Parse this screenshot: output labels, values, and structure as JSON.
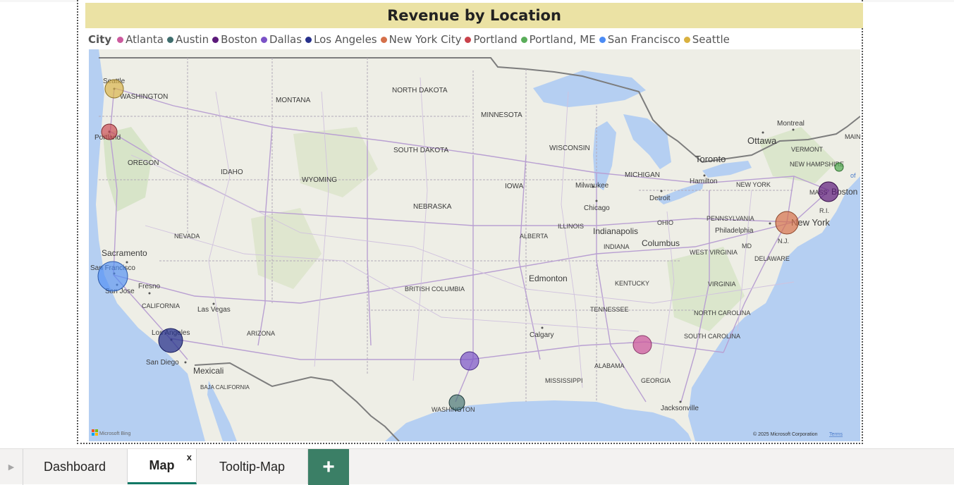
{
  "visual": {
    "title": "Revenue by Location"
  },
  "legend": {
    "title": "City",
    "items": [
      {
        "label": "Atlanta",
        "color": "#cc5a9e"
      },
      {
        "label": "Austin",
        "color": "#3f6e6e"
      },
      {
        "label": "Boston",
        "color": "#5c1a7a"
      },
      {
        "label": "Dallas",
        "color": "#7b52c7"
      },
      {
        "label": "Los Angeles",
        "color": "#27318c"
      },
      {
        "label": "New York City",
        "color": "#d5704a"
      },
      {
        "label": "Portland",
        "color": "#c9424b"
      },
      {
        "label": "Portland, ME",
        "color": "#5aad5a"
      },
      {
        "label": "San Francisco",
        "color": "#4c8cf5"
      },
      {
        "label": "Seattle",
        "color": "#d9b140"
      }
    ]
  },
  "map": {
    "bubbles": [
      {
        "city": "Seattle",
        "color": "#d9b140",
        "size": "medium"
      },
      {
        "city": "Portland",
        "color": "#c9424b",
        "size": "small"
      },
      {
        "city": "San Francisco",
        "color": "#4c8cf5",
        "size": "large"
      },
      {
        "city": "Los Angeles",
        "color": "#27318c",
        "size": "large"
      },
      {
        "city": "Dallas",
        "color": "#7b52c7",
        "size": "medium"
      },
      {
        "city": "Austin",
        "color": "#3f6e6e",
        "size": "small"
      },
      {
        "city": "Atlanta",
        "color": "#cc5a9e",
        "size": "medium"
      },
      {
        "city": "New York City",
        "color": "#d5704a",
        "size": "large"
      },
      {
        "city": "Boston",
        "color": "#5c1a7a",
        "size": "medium"
      },
      {
        "city": "Portland, ME",
        "color": "#5aad5a",
        "size": "tiny"
      }
    ],
    "labels": {
      "seattle": "Seattle",
      "washington": "WASHINGTON",
      "portland": "Portland",
      "oregon": "OREGON",
      "montana": "MONTANA",
      "idaho": "IDAHO",
      "wyoming": "WYOMING",
      "north_dakota": "NORTH DAKOTA",
      "south_dakota": "SOUTH DAKOTA",
      "minnesota": "MINNESOTA",
      "wisconsin": "WISCONSIN",
      "nebraska": "NEBRASKA",
      "iowa": "IOWA",
      "michigan": "MICHIGAN",
      "milwaukee": "Milwaukee",
      "chicago": "Chicago",
      "detroit": "Detroit",
      "toronto": "Toronto",
      "hamilton": "Hamilton",
      "ottawa": "Ottawa",
      "montreal": "Montreal",
      "vermont": "VERMONT",
      "new_hampshire": "NEW HAMPSHIRE",
      "maine": "MAIN",
      "mass": "MASS",
      "boston": "Boston",
      "ri": "R.I.",
      "new_york_state": "NEW YORK",
      "new_york": "New York",
      "pennsylvania": "PENNSYLVANIA",
      "philadelphia": "Philadelphia",
      "nj": "N.J.",
      "md": "MD",
      "delaware": "DELAWARE",
      "ohio": "OHIO",
      "illinois": "ILLINOIS",
      "indianapolis": "Indianapolis",
      "indiana": "INDIANA",
      "columbus": "Columbus",
      "west_virginia": "WEST VIRGINIA",
      "virginia": "VIRGINIA",
      "kentucky": "KENTUCKY",
      "north_carolina": "NORTH CAROLINA",
      "tennessee": "TENNESSEE",
      "south_carolina": "SOUTH CAROLINA",
      "alabama": "ALABAMA",
      "georgia": "GEORGIA",
      "mississippi": "MISSISSIPPI",
      "jacksonville": "Jacksonville",
      "alberta": "ALBERTA",
      "edmonton": "Edmonton",
      "calgary": "Calgary",
      "british_columbia": "BRITISH COLUMBIA",
      "nevada": "NEVADA",
      "sacramento": "Sacramento",
      "san_francisco": "San Francisco",
      "san_jose": "San Jose",
      "fresno": "Fresno",
      "california": "CALIFORNIA",
      "las_vegas": "Las Vegas",
      "los_angeles": "Los Angeles",
      "arizona": "ARIZONA",
      "san_diego": "San Diego",
      "mexicali": "Mexicali",
      "baja_california": "BAJA CALIFORNIA",
      "washington_dc": "WASHINGTON",
      "of": "of"
    },
    "bing_logo": "Microsoft Bing",
    "copyright": "© 2025 Microsoft Corporation",
    "terms": "Terms"
  },
  "tabs": {
    "items": [
      {
        "label": "Dashboard",
        "active": false
      },
      {
        "label": "Map",
        "active": true
      },
      {
        "label": "Tooltip-Map",
        "active": false
      }
    ],
    "close_label": "x",
    "add_label": "+",
    "nav_icon": "chevron-right-icon"
  }
}
